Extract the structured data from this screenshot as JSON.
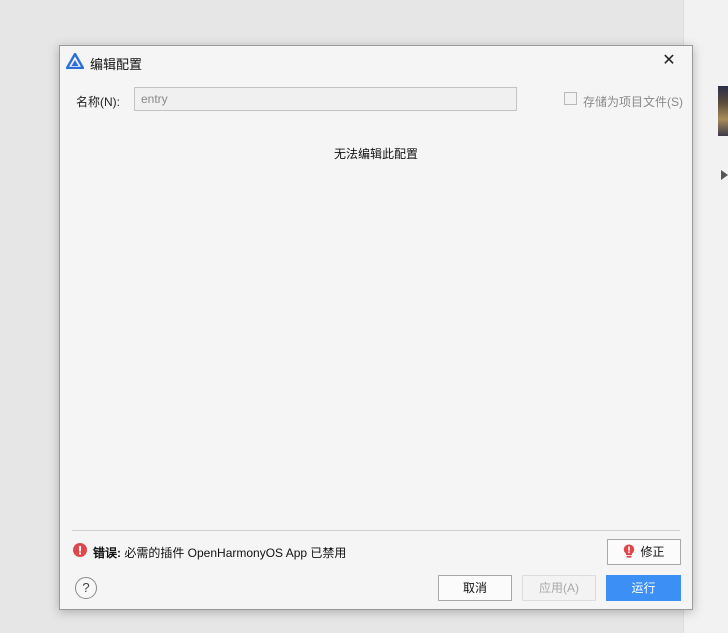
{
  "dialog": {
    "title": "编辑配置",
    "close_glyph": "✕",
    "name_label": "名称(N):",
    "name_value": "entry",
    "save_as_project_label": "存储为项目文件(S)",
    "save_as_project_checked": false,
    "message": "无法编辑此配置",
    "error_prefix": "错误:",
    "error_text": " 必需的插件 OpenHarmonyOS App 已禁用",
    "fix_label": "修正",
    "help_glyph": "?",
    "cancel_label": "取消",
    "apply_label": "应用(A)",
    "run_label": "运行"
  },
  "icons": {
    "title": "deveco-logo-icon",
    "close": "close-icon",
    "error": "error-circle-icon",
    "fix": "bulb-exclamation-icon",
    "help": "question-circle-icon"
  },
  "colors": {
    "primary_button": "#3b8ff5",
    "error": "#e0474c",
    "logo": "#2c6fd8"
  }
}
